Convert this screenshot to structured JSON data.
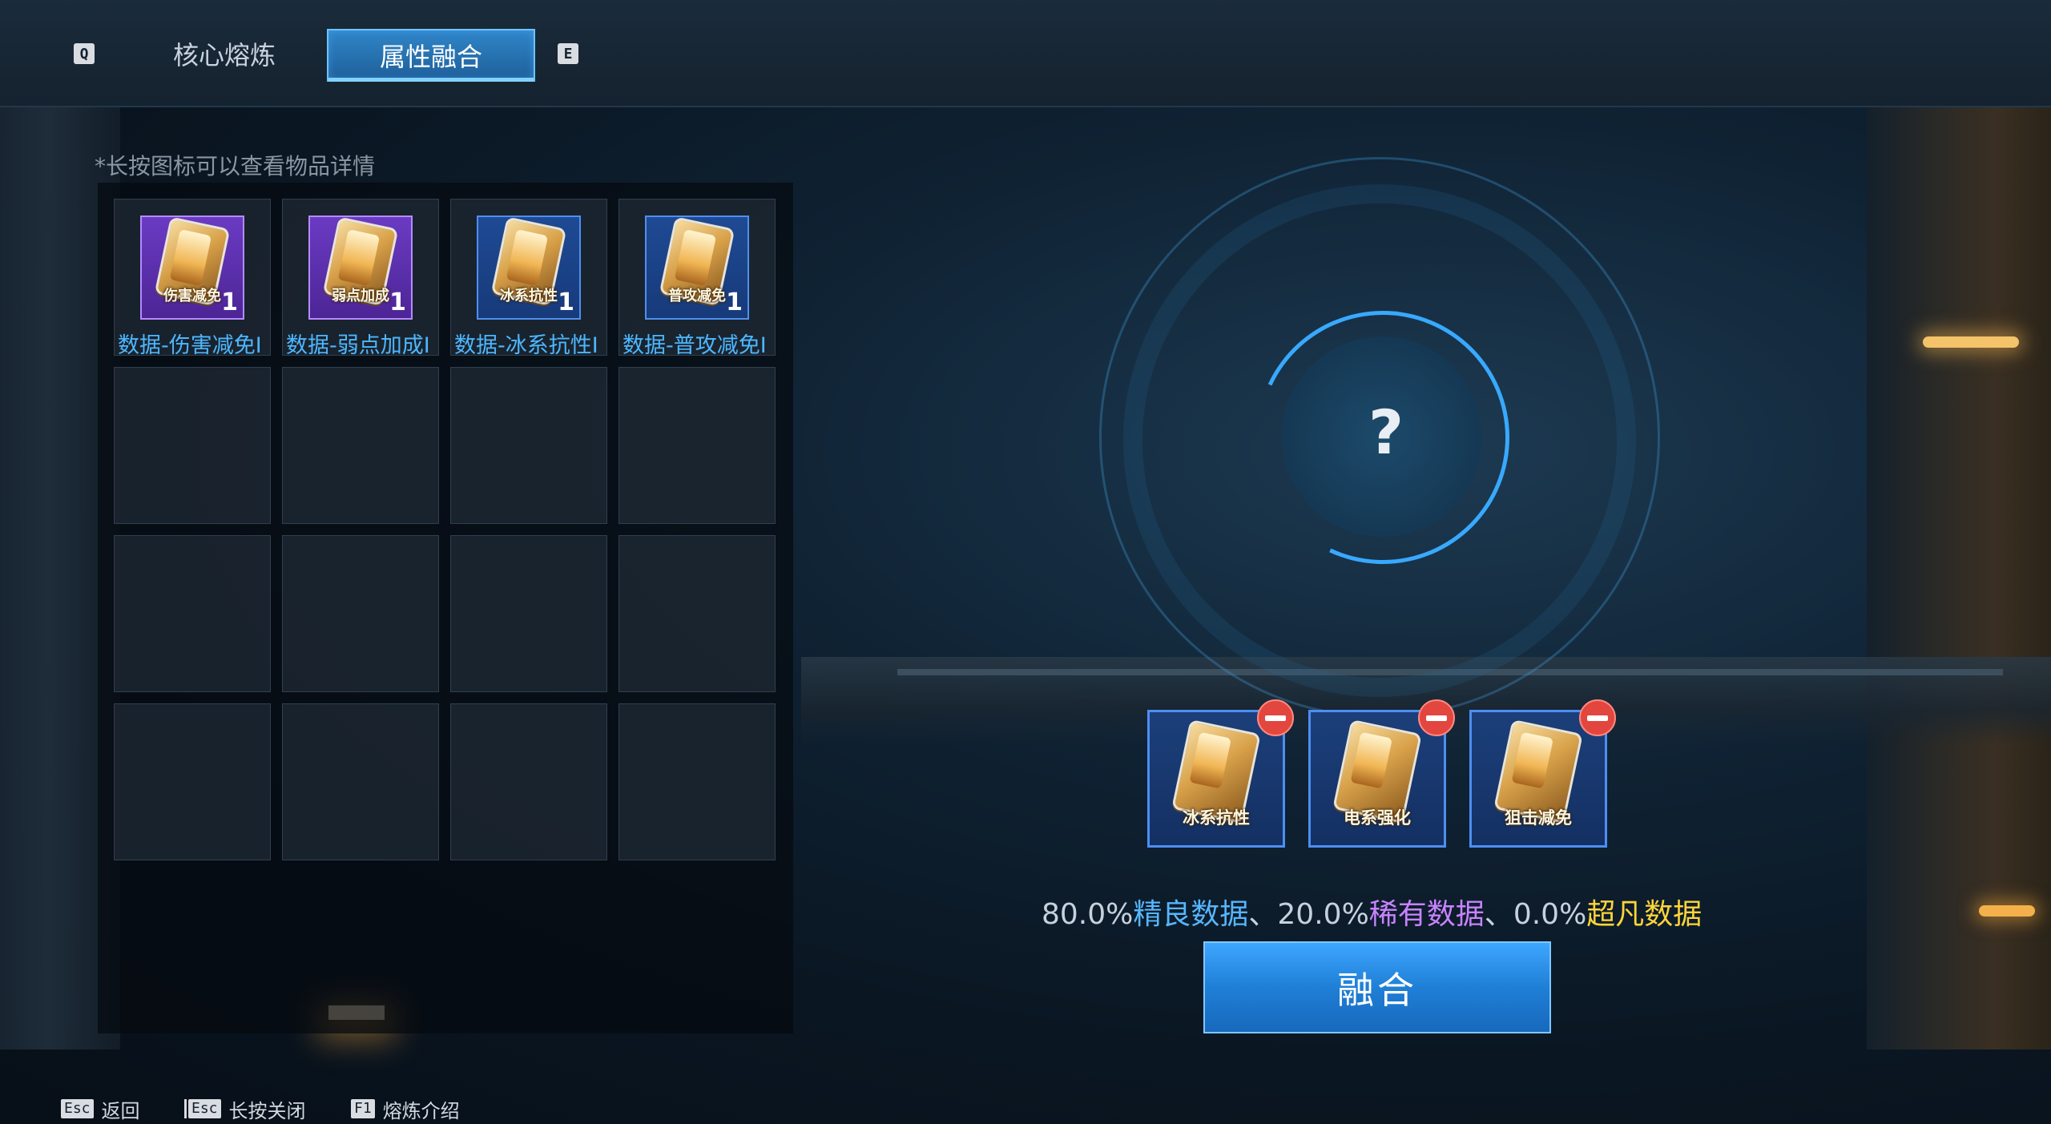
{
  "tabs": {
    "prev_key": "Q",
    "next_key": "E",
    "items": [
      {
        "label": "核心熔炼"
      },
      {
        "label": "属性融合"
      }
    ]
  },
  "inventory": {
    "hint": "*长按图标可以查看物品详情",
    "items": [
      {
        "name": "数据-伤害减免I",
        "icon_label": "伤害减免",
        "qty": "1",
        "rarity": "purple"
      },
      {
        "name": "数据-弱点加成I",
        "icon_label": "弱点加成",
        "qty": "1",
        "rarity": "purple"
      },
      {
        "name": "数据-冰系抗性I",
        "icon_label": "冰系抗性",
        "qty": "1",
        "rarity": "blue"
      },
      {
        "name": "数据-普攻减免I",
        "icon_label": "普攻减免",
        "qty": "1",
        "rarity": "blue"
      }
    ]
  },
  "fusion": {
    "result_symbol": "?",
    "materials": [
      {
        "icon_label": "冰系抗性"
      },
      {
        "icon_label": "电系强化"
      },
      {
        "icon_label": "狙击减免"
      }
    ],
    "odds": {
      "fine_pct": "80.0%",
      "fine_label": "精良数据",
      "sep1": "、",
      "rare_pct": "20.0%",
      "rare_label": "稀有数据",
      "sep2": "、",
      "epic_pct": "0.0%",
      "epic_label": "超凡数据"
    },
    "fuse_label": "融合"
  },
  "footer": [
    {
      "key": "Esc",
      "label": "返回"
    },
    {
      "key": "Esc",
      "label": "长按关闭"
    },
    {
      "key": "F1",
      "label": "熔炼介绍"
    }
  ],
  "colors": {
    "accent_blue": "#38a9ff",
    "fine": "#56b6ff",
    "rare": "#c883ff",
    "epic": "#ffd53a",
    "remove": "#e2463e"
  }
}
